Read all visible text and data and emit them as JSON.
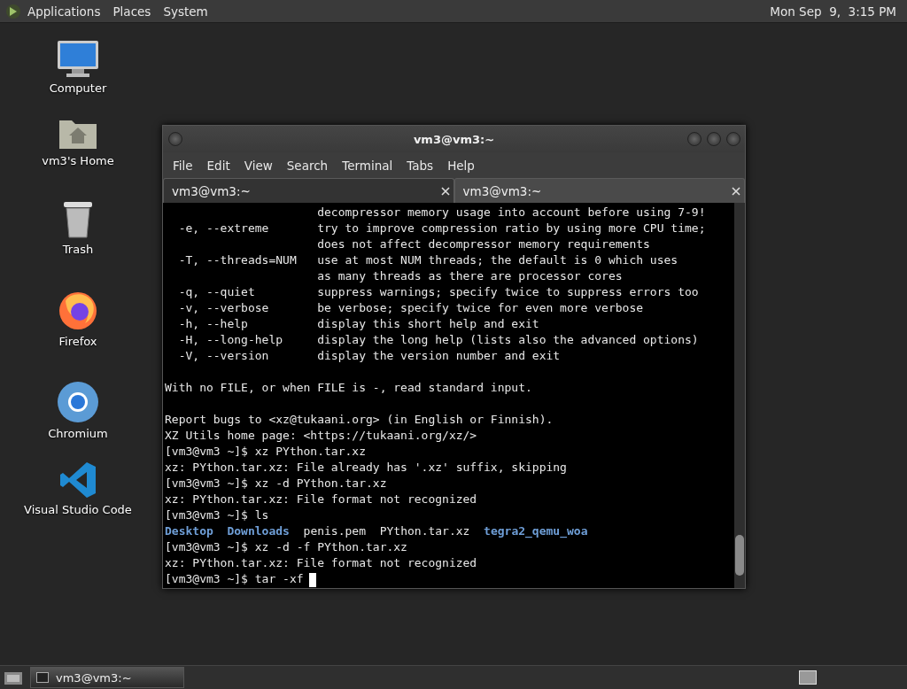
{
  "top_panel": {
    "menus": [
      "Applications",
      "Places",
      "System"
    ],
    "clock": "Mon Sep  9,  3:15 PM"
  },
  "desktop_icons": [
    {
      "label": "Computer",
      "kind": "computer"
    },
    {
      "label": "vm3's Home",
      "kind": "home"
    },
    {
      "label": "Trash",
      "kind": "trash"
    },
    {
      "label": "Firefox",
      "kind": "firefox"
    },
    {
      "label": "Chromium",
      "kind": "chromium"
    },
    {
      "label": "Visual Studio Code",
      "kind": "vscode"
    }
  ],
  "window": {
    "title": "vm3@vm3:~",
    "menu": [
      "File",
      "Edit",
      "View",
      "Search",
      "Terminal",
      "Tabs",
      "Help"
    ],
    "tabs": [
      {
        "label": "vm3@vm3:~",
        "selected": true
      },
      {
        "label": "vm3@vm3:~",
        "selected": false
      }
    ],
    "lines": [
      {
        "text": "                      decompressor memory usage into account before using 7-9!"
      },
      {
        "text": "  -e, --extreme       try to improve compression ratio by using more CPU time;"
      },
      {
        "text": "                      does not affect decompressor memory requirements"
      },
      {
        "text": "  -T, --threads=NUM   use at most NUM threads; the default is 0 which uses"
      },
      {
        "text": "                      as many threads as there are processor cores"
      },
      {
        "text": "  -q, --quiet         suppress warnings; specify twice to suppress errors too"
      },
      {
        "text": "  -v, --verbose       be verbose; specify twice for even more verbose"
      },
      {
        "text": "  -h, --help          display this short help and exit"
      },
      {
        "text": "  -H, --long-help     display the long help (lists also the advanced options)"
      },
      {
        "text": "  -V, --version       display the version number and exit"
      },
      {
        "kind": "blank"
      },
      {
        "text": "With no FILE, or when FILE is -, read standard input."
      },
      {
        "kind": "blank"
      },
      {
        "text": "Report bugs to <xz@tukaani.org> (in English or Finnish)."
      },
      {
        "text": "XZ Utils home page: <https://tukaani.org/xz/>"
      },
      {
        "text": "[vm3@vm3 ~]$ xz PYthon.tar.xz"
      },
      {
        "text": "xz: PYthon.tar.xz: File already has '.xz' suffix, skipping"
      },
      {
        "text": "[vm3@vm3 ~]$ xz -d PYthon.tar.xz"
      },
      {
        "text": "xz: PYthon.tar.xz: File format not recognized"
      },
      {
        "text": "[vm3@vm3 ~]$ ls"
      },
      {
        "kind": "listing",
        "items": [
          {
            "text": "Desktop",
            "kind": "directory"
          },
          {
            "text": "Downloads",
            "kind": "directory"
          },
          {
            "text": "penis.pem",
            "kind": "file"
          },
          {
            "text": "PYthon.tar.xz",
            "kind": "file"
          },
          {
            "text": "tegra2_qemu_woa",
            "kind": "directory"
          }
        ]
      },
      {
        "text": "[vm3@vm3 ~]$ xz -d -f PYthon.tar.xz"
      },
      {
        "text": "xz: PYthon.tar.xz: File format not recognized"
      },
      {
        "text": "[vm3@vm3 ~]$ tar -xf",
        "cursor": true
      }
    ]
  },
  "taskbar": {
    "items": [
      {
        "label": "vm3@vm3:~",
        "selected": true
      }
    ]
  }
}
